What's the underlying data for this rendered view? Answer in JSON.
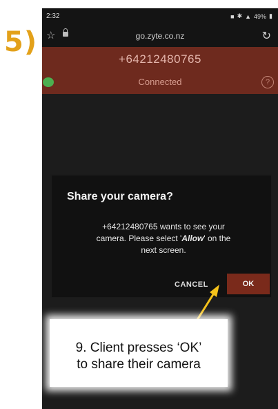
{
  "step": {
    "label": "5)"
  },
  "status_bar": {
    "time": "2:32",
    "right_icons": [
      "notification-icon",
      "bluetooth-icon",
      "signal-icon",
      "battery-icon"
    ],
    "battery": "49%"
  },
  "browser": {
    "url": "go.zyte.co.nz"
  },
  "call": {
    "number": "+64212480765",
    "status": "Connected",
    "help_glyph": "?"
  },
  "dialog": {
    "title": "Share your camera?",
    "message_line1": "+64212480765 wants to see your",
    "message_line2_prefix": "camera. Please select '",
    "message_line2_bold": "Allow",
    "message_line2_suffix": "' on the",
    "message_line3": "next screen.",
    "cancel_label": "CANCEL",
    "ok_label": "OK"
  },
  "annotation": {
    "line1": "9. Client presses ‘OK’",
    "line2": "to share their camera"
  },
  "colors": {
    "header": "#6e2a1e",
    "ok_button": "#7a2a1b",
    "step_label": "#e3a11a",
    "arrow": "#f5c21a"
  }
}
